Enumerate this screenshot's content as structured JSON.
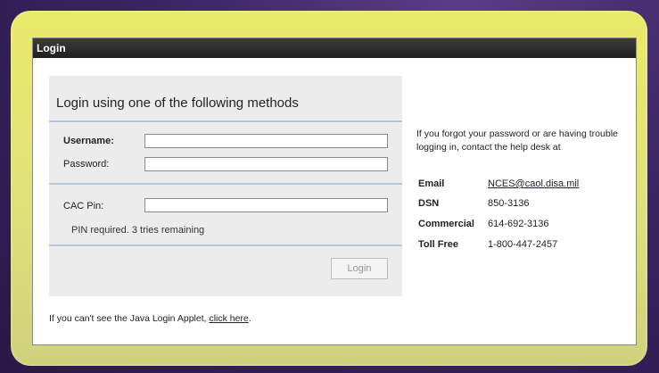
{
  "window": {
    "title": "Login"
  },
  "login_panel": {
    "heading": "Login using one of the following methods",
    "username_label": "Username:",
    "username_value": "",
    "password_label": "Password:",
    "password_value": "",
    "cac_pin_label": "CAC Pin:",
    "cac_pin_value": "",
    "pin_note": "PIN required. 3 tries remaining",
    "login_button": "Login"
  },
  "help": {
    "text": "If you forgot your password or are having trouble logging in, contact the help desk at",
    "contacts": [
      {
        "key": "Email",
        "value": "NCES@caol.disa.mil"
      },
      {
        "key": "DSN",
        "value": "850-3136"
      },
      {
        "key": "Commercial",
        "value": "614-692-3136"
      },
      {
        "key": "Toll Free",
        "value": "1-800-447-2457"
      }
    ]
  },
  "footer": {
    "prefix": "If you can't see the Java Login Applet, ",
    "link": "click here",
    "suffix": "."
  },
  "colors": {
    "frame": "#e2e36e",
    "background": "#3b2563",
    "titlebar": "#2b2b2b",
    "panel": "#ececec",
    "rule": "#b4c6e0"
  }
}
